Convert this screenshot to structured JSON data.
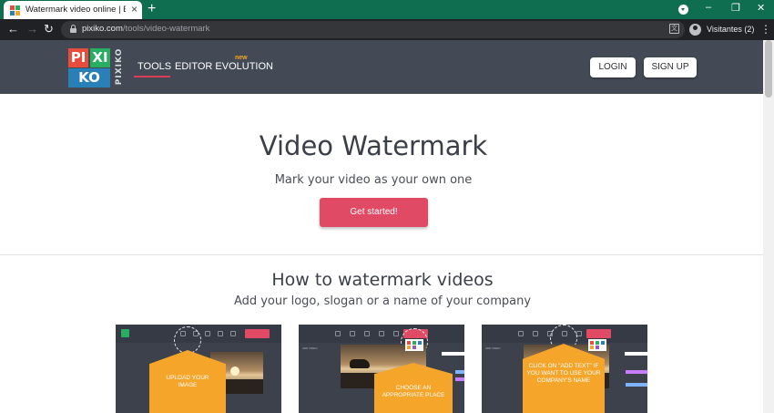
{
  "browser": {
    "tab_title": "Watermark video online | Brand y",
    "tab_close": "×",
    "new_tab": "+",
    "url_host": "pixiko.com",
    "url_path": "/tools/video-watermark",
    "profile_label": "Visitantes (2)",
    "nav_back": "←",
    "nav_forward": "→",
    "nav_reload": "↻",
    "menu": "⋮",
    "window_minimize": "–",
    "window_restore": "❐",
    "window_close": "✕",
    "tab_bar_color": "#0f6e50"
  },
  "site": {
    "logo": {
      "tiles": [
        {
          "letter": "PI",
          "color": "#e74c3c"
        },
        {
          "letter": "XI",
          "color": "#27ae60"
        },
        {
          "letter": "KO",
          "color": "#2980b9"
        }
      ],
      "side_text": "PIXIKO"
    },
    "nav": {
      "tools": "TOOLS",
      "editor": "EDITOR EVOLUTION",
      "new_badge": "new"
    },
    "login": "LOGIN",
    "signup": "SIGN UP",
    "header_color": "#434a55",
    "accent_color": "#e04a64"
  },
  "hero": {
    "title": "Video Watermark",
    "subtitle": "Mark your video as your own one",
    "cta": "Get started!"
  },
  "howto": {
    "title": "How to watermark videos",
    "subtitle": "Add your logo, slogan or a name of your company",
    "steps": [
      {
        "text": "UPLOAD YOUR IMAGE"
      },
      {
        "text": "CHOOSE AN APPROPRIATE PLACE"
      },
      {
        "text": "CLICK ON \"ADD TEXT\" IF YOU WANT TO USE YOUR COMPANY'S NAME"
      }
    ],
    "step_color": "#f4a52a"
  }
}
